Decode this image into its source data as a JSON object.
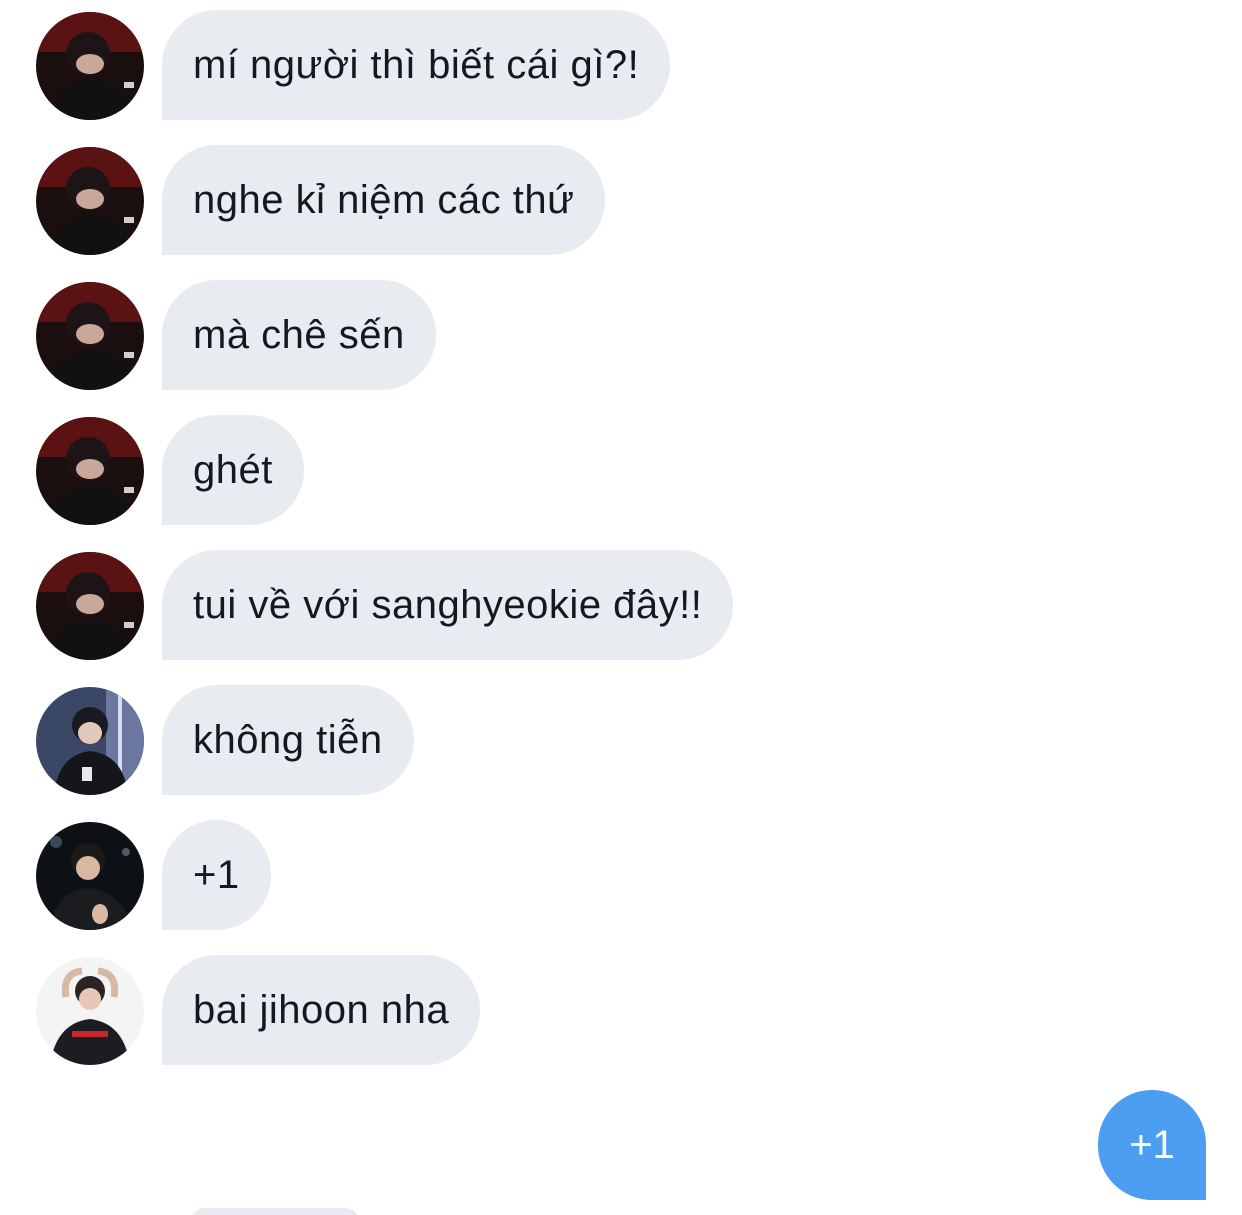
{
  "messages": [
    {
      "sender_avatar": "avatar-1",
      "text": "mí người thì biết cái gì?!"
    },
    {
      "sender_avatar": "avatar-1",
      "text": "nghe kỉ niệm các thứ"
    },
    {
      "sender_avatar": "avatar-1",
      "text": "mà chê sến"
    },
    {
      "sender_avatar": "avatar-1",
      "text": "ghét"
    },
    {
      "sender_avatar": "avatar-1",
      "text": "tui về với sanghyeokie đây!!"
    },
    {
      "sender_avatar": "avatar-2",
      "text": "không tiễn"
    },
    {
      "sender_avatar": "avatar-3",
      "text": "+1"
    },
    {
      "sender_avatar": "avatar-4",
      "text": "bai jihoon nha"
    }
  ],
  "sent_message": {
    "text": "+1"
  },
  "colors": {
    "received_bubble": "#e8ebef",
    "sent_bubble": "#4b9ef0",
    "text": "#141823"
  }
}
